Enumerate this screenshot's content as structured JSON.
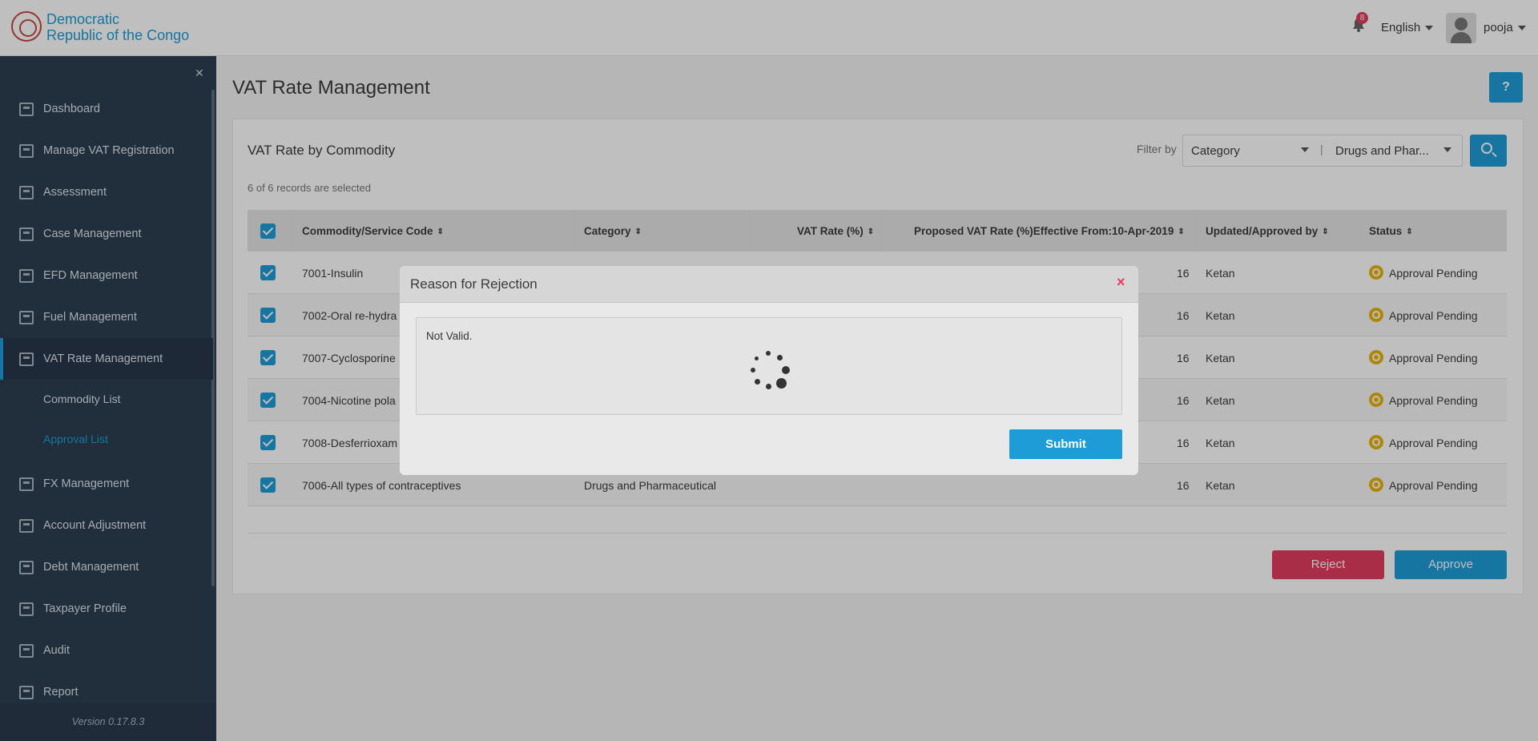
{
  "header": {
    "brand_line1": "Democratic",
    "brand_line2": "Republic of the Congo",
    "notification_count": "8",
    "language": "English",
    "username": "pooja"
  },
  "sidebar": {
    "items": [
      {
        "label": "Dashboard"
      },
      {
        "label": "Manage VAT Registration"
      },
      {
        "label": "Assessment"
      },
      {
        "label": "Case Management"
      },
      {
        "label": "EFD Management"
      },
      {
        "label": "Fuel Management"
      },
      {
        "label": "VAT Rate Management"
      },
      {
        "label": "FX Management"
      },
      {
        "label": "Account Adjustment"
      },
      {
        "label": "Debt Management"
      },
      {
        "label": "Taxpayer Profile"
      },
      {
        "label": "Audit"
      },
      {
        "label": "Report"
      }
    ],
    "subitems": [
      {
        "label": "Commodity List"
      },
      {
        "label": "Approval List"
      }
    ],
    "version": "Version 0.17.8.3"
  },
  "page": {
    "title": "VAT Rate Management",
    "help_label": "?",
    "card_title": "VAT Rate by Commodity",
    "filter_label": "Filter by",
    "filter_category": "Category",
    "filter_separator": "|",
    "filter_value": "Drugs and Phar...",
    "selected_count": "6 of 6 records are selected",
    "reject_label": "Reject",
    "approve_label": "Approve"
  },
  "table": {
    "columns": [
      "Commodity/Service Code",
      "Category",
      "VAT Rate (%)",
      "Proposed VAT Rate (%)Effective From:10-Apr-2019",
      "Updated/Approved by",
      "Status"
    ],
    "rows": [
      {
        "code": "7001-Insulin",
        "category": "",
        "vat": "",
        "proposed": "16",
        "by": "Ketan",
        "status": "Approval Pending"
      },
      {
        "code": "7002-Oral re-hydra",
        "category": "",
        "vat": "",
        "proposed": "16",
        "by": "Ketan",
        "status": "Approval Pending"
      },
      {
        "code": "7007-Cyclosporine",
        "category": "",
        "vat": "",
        "proposed": "16",
        "by": "Ketan",
        "status": "Approval Pending"
      },
      {
        "code": "7004-Nicotine pola",
        "category": "",
        "vat": "",
        "proposed": "16",
        "by": "Ketan",
        "status": "Approval Pending"
      },
      {
        "code": "7008-Desferrioxam",
        "category": "",
        "vat": "",
        "proposed": "16",
        "by": "Ketan",
        "status": "Approval Pending"
      },
      {
        "code": "7006-All types of contraceptives",
        "category": "Drugs and Pharmaceutical",
        "vat": "",
        "proposed": "16",
        "by": "Ketan",
        "status": "Approval Pending"
      }
    ]
  },
  "modal": {
    "title": "Reason for Rejection",
    "close_label": "×",
    "reason_text": "Not Valid.",
    "submit_label": "Submit"
  },
  "colors": {
    "accent": "#1e9cd7",
    "danger": "#e23d5f",
    "pending": "#e9b50e",
    "sidebar_bg": "#2d3e50"
  }
}
